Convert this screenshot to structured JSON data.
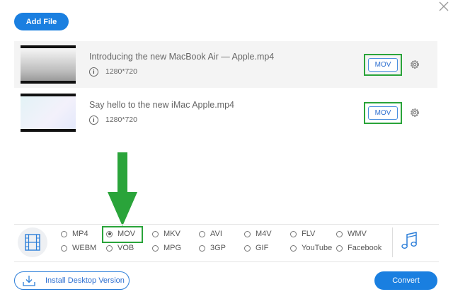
{
  "toolbar": {
    "add_file_label": "Add File"
  },
  "files": [
    {
      "name": "Introducing the new MacBook Air — Apple.mp4",
      "resolution": "1280*720",
      "format": "MOV"
    },
    {
      "name": "Say hello to the new iMac Apple.mp4",
      "resolution": "1280*720",
      "format": "MOV"
    }
  ],
  "formats": {
    "selected": "MOV",
    "row1": [
      "MP4",
      "MOV",
      "MKV",
      "AVI",
      "M4V",
      "FLV",
      "WMV"
    ],
    "row2": [
      "WEBM",
      "VOB",
      "MPG",
      "3GP",
      "GIF",
      "YouTube",
      "Facebook"
    ]
  },
  "footer": {
    "install_label": "Install Desktop Version",
    "convert_label": "Convert"
  },
  "colors": {
    "accent": "#1a7fe0",
    "highlight": "#2aa43a",
    "row_bg": "#f4f4f4"
  },
  "icons": [
    "close-icon",
    "info-icon",
    "gear-icon",
    "down-arrow-annotation",
    "film-icon",
    "music-note-icon",
    "download-icon"
  ]
}
